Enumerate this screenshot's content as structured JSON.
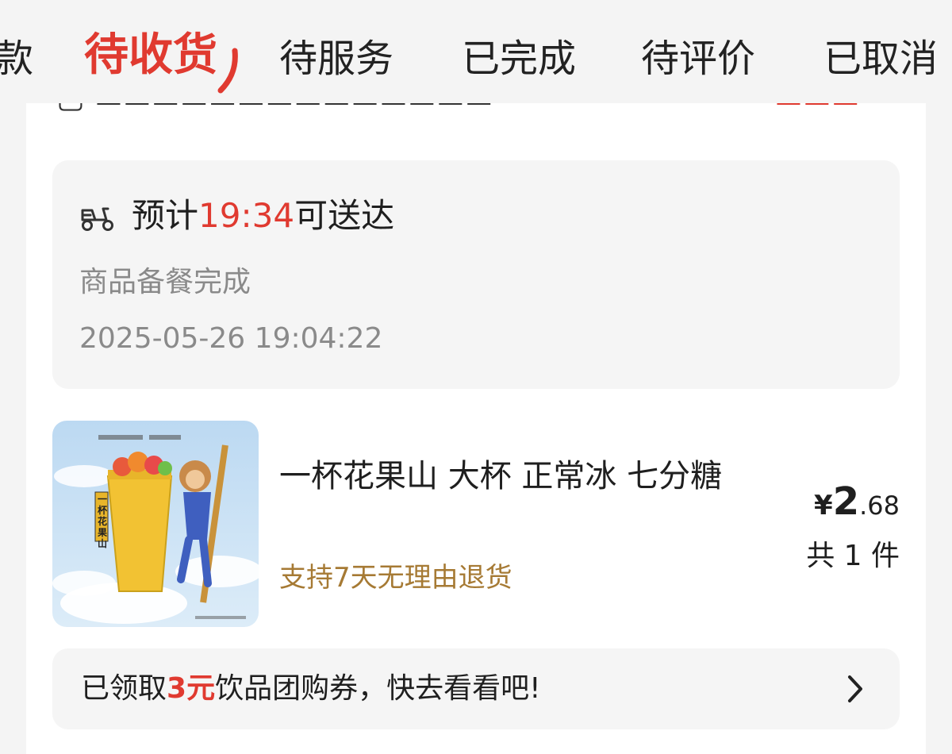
{
  "tabs": {
    "partial_left": "款",
    "active": "待收货",
    "items": [
      "待服务",
      "已完成",
      "待评价",
      "已取消"
    ]
  },
  "delivery": {
    "eta_prefix": "预计",
    "eta_time": "19:34",
    "eta_suffix": "可送达",
    "status": "商品备餐完成",
    "status_time": "2025-05-26 19:04:22",
    "icon": "scooter-icon"
  },
  "product": {
    "name": "一杯花果山 大杯 正常冰 七分糖",
    "return_policy": "支持7天无理由退货",
    "price_currency": "¥",
    "price_integer": "2",
    "price_decimal": ".68",
    "quantity": "共 1 件",
    "image_cup_label": "一杯花果山"
  },
  "coupon": {
    "prefix": "已领取",
    "amount": "3元",
    "suffix": "饮品团购券，快去看看吧!",
    "icon": "chevron-right-icon"
  },
  "colors": {
    "accent": "#e03a30",
    "policy": "#a67a34",
    "muted": "#8a8a8a"
  }
}
